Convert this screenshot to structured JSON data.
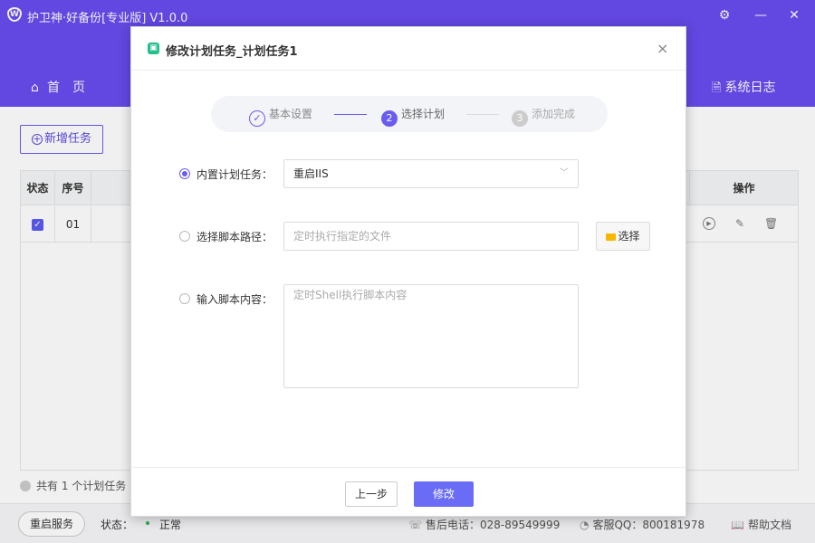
{
  "app": {
    "title": "护卫神·好备份[专业版]  V1.0.0",
    "logo_letter": "W"
  },
  "nav": {
    "home": "首　页",
    "log": "系统日志"
  },
  "toolbar": {
    "add_task": "新增任务"
  },
  "table": {
    "headers": {
      "status": "状态",
      "index": "序号",
      "actions": "操作"
    },
    "rows": [
      {
        "index": "01",
        "checked": true
      }
    ],
    "count_text": "共有 1 个计划任务"
  },
  "statusbar": {
    "restart": "重启服务",
    "status_label": "状态：",
    "status_value": "正常",
    "phone": "售后电话：028-89549999",
    "qq": "客服QQ：800181978",
    "help": "帮助文档"
  },
  "dialog": {
    "title": "修改计划任务_计划任务1",
    "close": "×",
    "steps": [
      {
        "num": "✓",
        "label": "基本设置"
      },
      {
        "num": "2",
        "label": "选择计划"
      },
      {
        "num": "3",
        "label": "添加完成"
      }
    ],
    "builtin_label": "内置计划任务：",
    "builtin_value": "重启IIS",
    "script_path_label": "选择脚本路径：",
    "script_path_placeholder": "定时执行指定的文件",
    "choose_button": "选择",
    "script_content_label": "输入脚本内容：",
    "script_content_placeholder": "定时Shell执行脚本内容",
    "prev_button": "上一步",
    "submit_button": "修改"
  },
  "colors": {
    "accent": "#6a4cf0",
    "primary_button": "#6a6cf5",
    "success": "#2db55d"
  }
}
